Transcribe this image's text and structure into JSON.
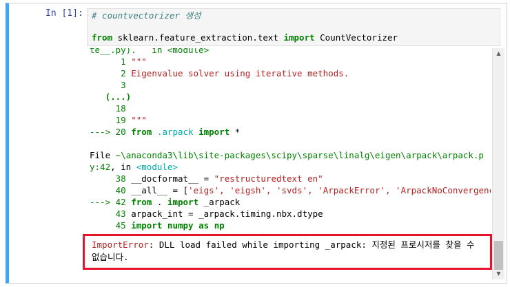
{
  "input": {
    "prompt": "In [1]:",
    "comment": "# countvectorizer  생성",
    "code_from": "from",
    "code_module": "sklearn.feature_extraction.text",
    "code_import": "import",
    "code_name": "CountVectorizer"
  },
  "output": {
    "partial_top": "te__.py).   in <module>",
    "l1_num": "1",
    "l1_code": "\"\"\"",
    "l2_num": "2",
    "l2_code": "Eigenvalue solver using iterative methods.",
    "l3_num": "3",
    "ellipsis": "(...)",
    "l18_num": "18",
    "l19_num": "19",
    "l19_code": "\"\"\"",
    "arrow1": "--->",
    "l20_num": "20",
    "l20_from": "from",
    "l20_mod": ".arpack",
    "l20_import": "import",
    "l20_star": "*",
    "file_prefix": "File",
    "file_path": "~\\anaconda3\\lib\\site-packages\\scipy\\sparse\\linalg\\eigen\\arpack\\arpack.py:42",
    "file_in": ", in",
    "file_module": "<module>",
    "l38_num": "38",
    "l38_code": "__docformat__ = ",
    "l38_str": "\"restructuredtext en\"",
    "l40_num": "40",
    "l40_code": "__all__ = [",
    "l40_str": "'eigs', 'eigsh', 'svds', 'ArpackError', 'ArpackNoConvergence'",
    "l40_end": "]",
    "arrow2": "--->",
    "l42_num": "42",
    "l42_from": "from",
    "l42_dot": ".",
    "l42_import": "import",
    "l42_name": "_arpack",
    "l43_num": "43",
    "l43_code": "arpack_int = _arpack.timing.nbx.dtype",
    "l45_num": "45",
    "l45_import": "import",
    "l45_mod": "numpy",
    "l45_as": "as",
    "l45_alias": "np"
  },
  "error": {
    "name": "ImportError",
    "message": ": DLL load failed while importing _arpack: 지정된 프로시저를 찾을 수 없습니다."
  }
}
